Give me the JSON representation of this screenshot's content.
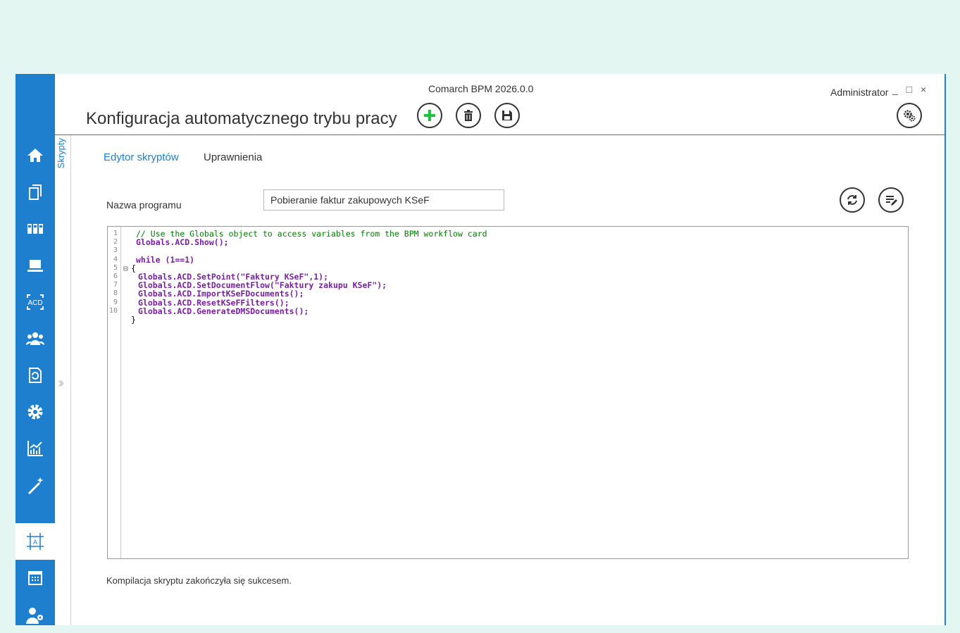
{
  "window": {
    "title": "Comarch BPM 2026.0.0",
    "user": "Administrator",
    "controls": "_ □ ×"
  },
  "page": {
    "title": "Konfiguracja automatycznego trybu pracy"
  },
  "toolbar": [
    "add-icon",
    "delete-icon",
    "save-icon"
  ],
  "sidebar": {
    "items": [
      "home-icon",
      "documents-icon",
      "workflow-icon",
      "laptop-icon",
      "acd-icon",
      "users-icon",
      "refresh-document-icon",
      "settings-icon",
      "analytics-icon",
      "wand-icon",
      "script-editor-icon",
      "calendar-icon",
      "user-settings-icon"
    ],
    "active": "script-editor-icon",
    "acd_label": "ACD"
  },
  "strip": {
    "label": "Skrypty"
  },
  "tabs": [
    {
      "label": "Edytor skryptów",
      "active": true
    },
    {
      "label": "Uprawnienia",
      "active": false
    }
  ],
  "form": {
    "program_name_label": "Nazwa programu",
    "program_name_value": "Pobieranie faktur zakupowych KSeF"
  },
  "editor": {
    "lines": [
      {
        "n": "1",
        "text": "// Use the Globals object to access variables from the BPM workflow card"
      },
      {
        "n": "2",
        "text": "Globals.ACD.Show();"
      },
      {
        "n": "3",
        "text": ""
      },
      {
        "n": "4",
        "text": "while (1==1)"
      },
      {
        "n": "5",
        "text": "{"
      },
      {
        "n": "6",
        "text": "Globals.ACD.SetPoint(\"Faktury KSeF\",1);"
      },
      {
        "n": "7",
        "text": "Globals.ACD.SetDocumentFlow(\"Faktury zakupu KSeF\");"
      },
      {
        "n": "8",
        "text": "Globals.ACD.ImportKSeFDocuments();"
      },
      {
        "n": "9",
        "text": "Globals.ACD.ResetKSeFFilters();"
      },
      {
        "n": "10",
        "text": "Globals.ACD.GenerateDMSDocuments();"
      },
      {
        "n": "",
        "text": "}"
      }
    ]
  },
  "status": "Kompilacja skryptu zakończyła się sukcesem.",
  "colors": {
    "accent": "#1e7fcf",
    "background": "#e3f6f1",
    "add_icon": "#1fc23a"
  }
}
